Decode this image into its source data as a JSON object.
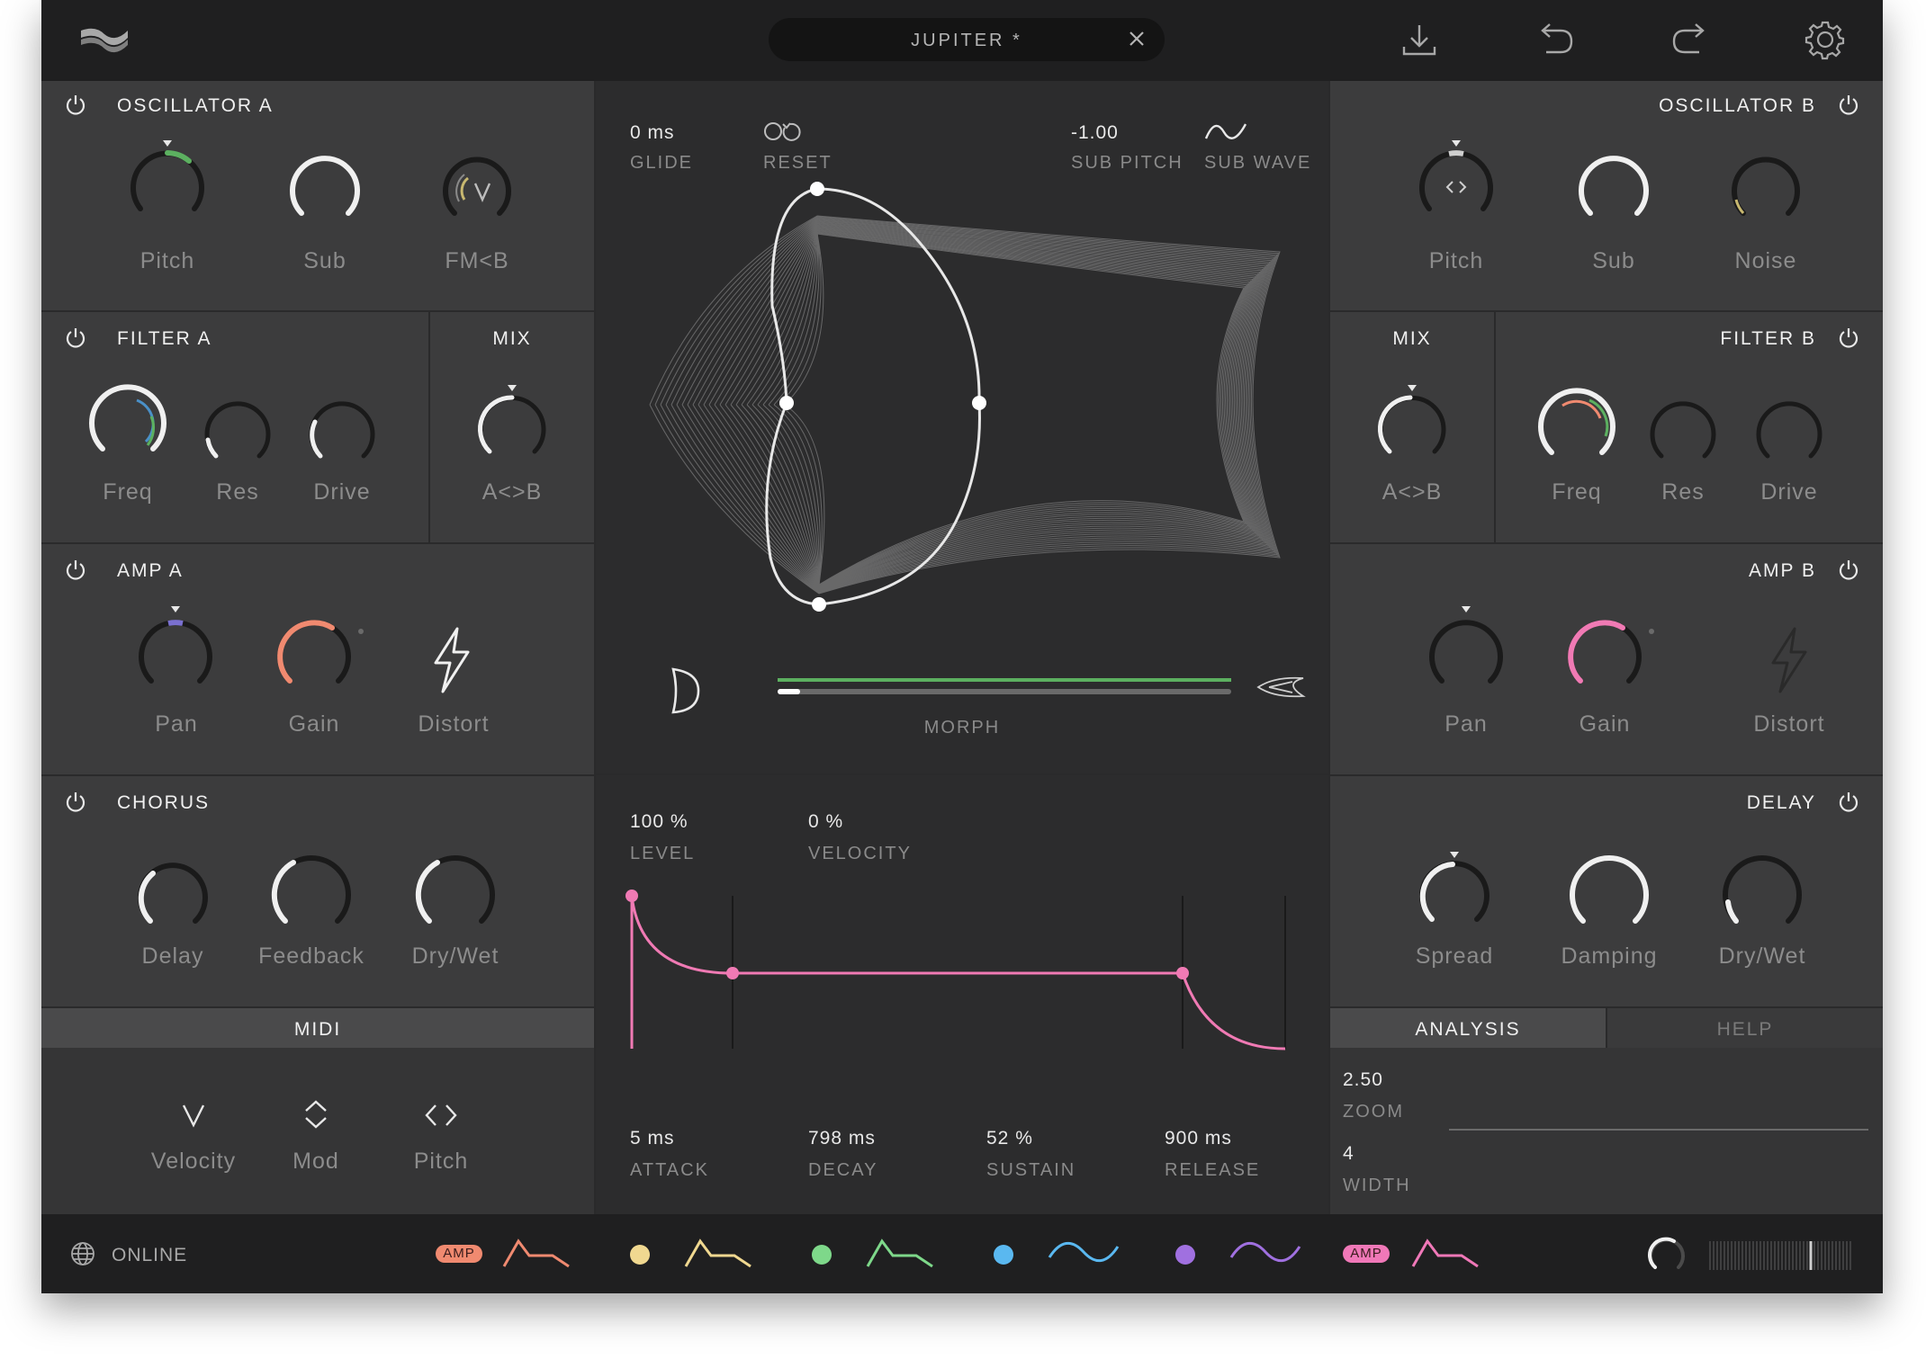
{
  "app": {
    "preset_name": "JUPITER *",
    "status": "ONLINE"
  },
  "osc_a": {
    "title": "OSCILLATOR A",
    "knobs": [
      "Pitch",
      "Sub",
      "FM<B"
    ]
  },
  "filter_a": {
    "title": "FILTER A",
    "knobs": [
      "Freq",
      "Res",
      "Drive"
    ]
  },
  "mix_a": {
    "title": "MIX",
    "knob": "A<>B"
  },
  "amp_a": {
    "title": "AMP A",
    "knobs": [
      "Pan",
      "Gain",
      "Distort"
    ]
  },
  "chorus": {
    "title": "CHORUS",
    "knobs": [
      "Delay",
      "Feedback",
      "Dry/Wet"
    ]
  },
  "midi": {
    "title": "MIDI",
    "items": [
      "Velocity",
      "Mod",
      "Pitch"
    ]
  },
  "osc_b": {
    "title": "OSCILLATOR B",
    "knobs": [
      "Pitch",
      "Sub",
      "Noise"
    ]
  },
  "mix_b": {
    "title": "MIX",
    "knob": "A<>B"
  },
  "filter_b": {
    "title": "FILTER B",
    "knobs": [
      "Freq",
      "Res",
      "Drive"
    ]
  },
  "amp_b": {
    "title": "AMP B",
    "knobs": [
      "Pan",
      "Gain",
      "Distort"
    ]
  },
  "delay": {
    "title": "DELAY",
    "knobs": [
      "Spread",
      "Damping",
      "Dry/Wet"
    ]
  },
  "analysis": {
    "tabs": [
      "ANALYSIS",
      "HELP"
    ],
    "zoom_value": "2.50",
    "zoom_label": "ZOOM",
    "width_value": "4",
    "width_label": "WIDTH"
  },
  "morph_panel": {
    "glide_value": "0 ms",
    "glide_label": "GLIDE",
    "reset_label": "RESET",
    "sub_pitch_value": "-1.00",
    "sub_pitch_label": "SUB PITCH",
    "sub_wave_label": "SUB WAVE",
    "morph_label": "MORPH",
    "morph_amount": 0.05
  },
  "envelope": {
    "level_value": "100 %",
    "level_label": "LEVEL",
    "velocity_value": "0 %",
    "velocity_label": "VELOCITY",
    "attack_value": "5 ms",
    "attack_label": "ATTACK",
    "decay_value": "798 ms",
    "decay_label": "DECAY",
    "sustain_value": "52 %",
    "sustain_label": "SUSTAIN",
    "release_value": "900 ms",
    "release_label": "RELEASE"
  },
  "modulators": {
    "amp_badge": "AMP",
    "colors": {
      "env1": "#f08a70",
      "env2": "#f0d890",
      "env3": "#7ed88a",
      "lfo1": "#5ab8f0",
      "lfo2": "#a070e0",
      "env4": "#f078b8"
    }
  },
  "colors": {
    "accent_pink": "#f07ab4",
    "accent_green": "#5cb060",
    "panel": "#3c3c3d"
  }
}
